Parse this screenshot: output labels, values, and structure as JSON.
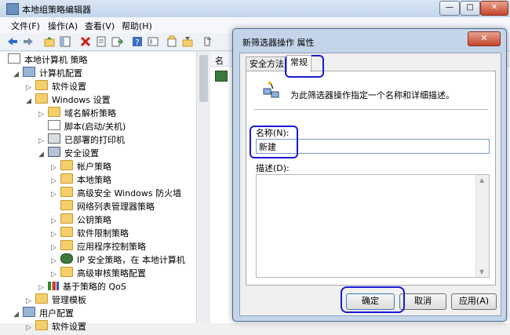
{
  "main_window": {
    "title": "本地组策略编辑器",
    "caption_buttons": [
      "—",
      "□",
      "✕"
    ]
  },
  "menu": [
    "文件(F)",
    "操作(A)",
    "查看(V)",
    "帮助(H)"
  ],
  "tree": [
    {
      "label": "本地计算机 策略",
      "arrow": "",
      "icon": "doc"
    },
    {
      "label": "计算机配置",
      "arrow": "◢",
      "icon": "pc"
    },
    {
      "label": "软件设置",
      "arrow": "▷",
      "icon": "folder"
    },
    {
      "label": "Windows 设置",
      "arrow": "◢",
      "icon": "folder"
    },
    {
      "label": "域名解析策略",
      "arrow": "▷",
      "icon": "folder"
    },
    {
      "label": "脚本(启动/关机)",
      "arrow": "",
      "icon": "script"
    },
    {
      "label": "已部署的打印机",
      "arrow": "▷",
      "icon": "printer"
    },
    {
      "label": "安全设置",
      "arrow": "◢",
      "icon": "security"
    },
    {
      "label": "帐户策略",
      "arrow": "▷",
      "icon": "lockfolder"
    },
    {
      "label": "本地策略",
      "arrow": "▷",
      "icon": "lockfolder"
    },
    {
      "label": "高级安全 Windows 防火墙",
      "arrow": "▷",
      "icon": "folder"
    },
    {
      "label": "网络列表管理器策略",
      "arrow": "",
      "icon": "folder"
    },
    {
      "label": "公钥策略",
      "arrow": "▷",
      "icon": "folder"
    },
    {
      "label": "软件限制策略",
      "arrow": "▷",
      "icon": "folder"
    },
    {
      "label": "应用程序控制策略",
      "arrow": "▷",
      "icon": "folder"
    },
    {
      "label": "IP 安全策略，在 本地计算机",
      "arrow": "▷",
      "icon": "ipsec"
    },
    {
      "label": "高级审核策略配置",
      "arrow": "▷",
      "icon": "folder"
    },
    {
      "label": "基于策略的 QoS",
      "arrow": "▷",
      "icon": "chart"
    },
    {
      "label": "管理模板",
      "arrow": "▷",
      "icon": "folder"
    },
    {
      "label": "用户配置",
      "arrow": "◢",
      "icon": "pc"
    },
    {
      "label": "软件设置",
      "arrow": "▷",
      "icon": "folder"
    }
  ],
  "right_pane": {
    "column_header": "名",
    "row_icon": "policy"
  },
  "dialog": {
    "title": "新筛选器操作 属性",
    "close_label": "✕",
    "tabs": [
      "安全方法",
      "常规"
    ],
    "active_tab": "常规",
    "description_text": "为此筛选器操作指定一个名称和详细描述。",
    "name_label": "名称(N):",
    "name_value": "新建",
    "desc_label": "描述(D):",
    "desc_value": "",
    "buttons": {
      "ok": "确定",
      "cancel": "取消",
      "apply": "应用(A)"
    }
  }
}
